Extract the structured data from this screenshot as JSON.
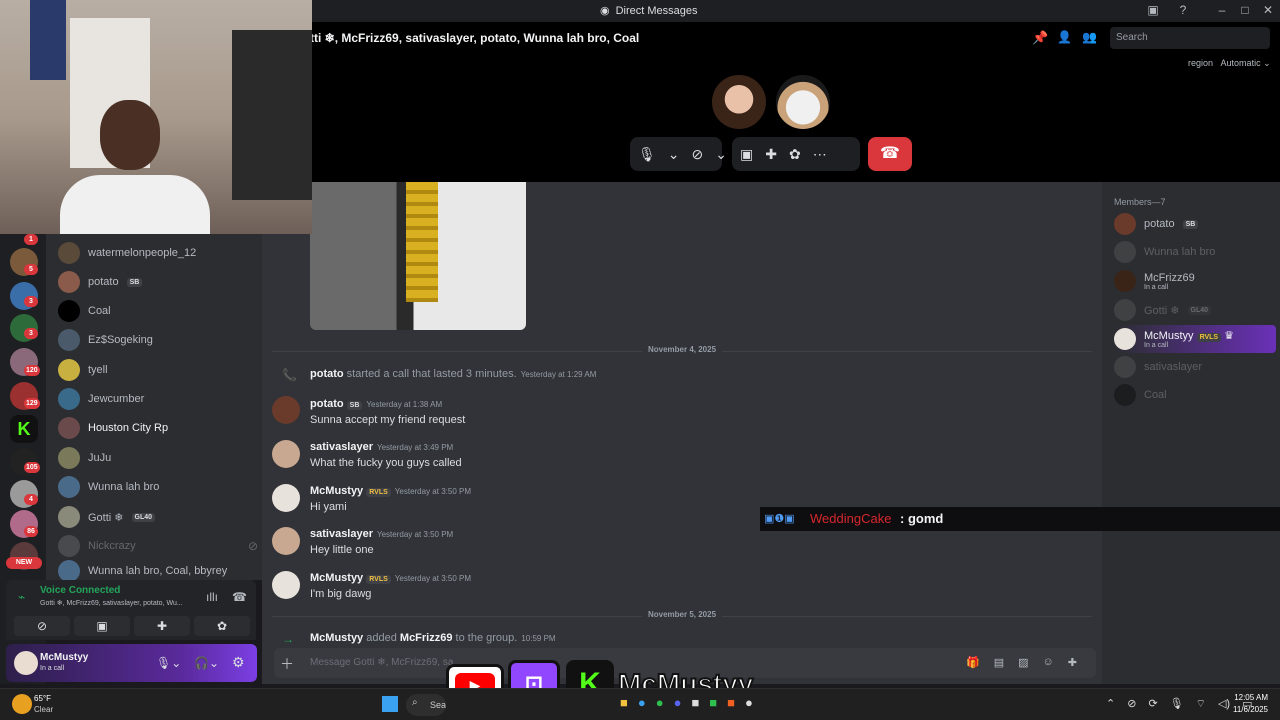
{
  "window": {
    "title": "Direct Messages"
  },
  "call": {
    "participants": "tti ❄, McFrizz69, sativaslayer, potato, Wunna lah bro, Coal",
    "search_placeholder": "Search",
    "region_label": "region",
    "region_value": "Automatic"
  },
  "servers": {
    "badges": [
      "1",
      "5",
      "3",
      "3",
      "120",
      "129",
      "105",
      "4",
      "86"
    ],
    "new_label": "NEW"
  },
  "dms": [
    {
      "name": "watermelonpeople_12",
      "tag": ""
    },
    {
      "name": "potato",
      "tag": "SB"
    },
    {
      "name": "Coal",
      "tag": ""
    },
    {
      "name": "Ez$Sogeking",
      "tag": ""
    },
    {
      "name": "tyell",
      "tag": ""
    },
    {
      "name": "Jewcumber",
      "tag": ""
    },
    {
      "name": "Houston City Rp",
      "tag": ""
    },
    {
      "name": "JuJu",
      "tag": ""
    },
    {
      "name": "Wunna lah bro",
      "tag": ""
    },
    {
      "name": "Gotti ❄",
      "tag": "GL40"
    },
    {
      "name": "Nickcrazy",
      "tag": ""
    },
    {
      "name": "Wunna lah bro, Coal, bbyrey",
      "tag": ""
    }
  ],
  "voice": {
    "status": "Voice Connected",
    "channel": "Gotti ❄, McFrizz69, sativaslayer, potato, Wu..."
  },
  "user": {
    "name": "McMustyy",
    "status": "In a call"
  },
  "messages": {
    "date1": "November 4, 2025",
    "call_user": "potato",
    "call_text": "started a call that lasted 3 minutes.",
    "call_ts": "Yesterday at 1:29 AM",
    "m1_name": "potato",
    "m1_tag": "SB",
    "m1_ts": "Yesterday at 1:38 AM",
    "m1_text": "Sunna accept my friend request",
    "m2_name": "sativaslayer",
    "m2_ts": "Yesterday at 3:49 PM",
    "m2_text": "What the fucky you guys called",
    "m3_name": "McMustyy",
    "m3_tag": "RVLS",
    "m3_ts": "Yesterday at 3:50 PM",
    "m3_text": "Hi yami",
    "m4_name": "sativaslayer",
    "m4_ts": "Yesterday at 3:50 PM",
    "m4_text": "Hey little one",
    "m5_name": "McMustyy",
    "m5_tag": "RVLS",
    "m5_ts": "Yesterday at 3:50 PM",
    "m5_text": "I'm big dawg",
    "date2": "November 5, 2025",
    "add_user": "McMustyy",
    "add_text": "added",
    "add_target": "McFrizz69",
    "add_suffix": "to the group.",
    "add_ts": "10:59 PM",
    "composer_placeholder": "Message Gotti ❄, McFrizz69, sa..."
  },
  "members": {
    "header": "Members—7",
    "list": [
      {
        "name": "potato",
        "tag": "SB",
        "sub": ""
      },
      {
        "name": "Wunna lah bro",
        "tag": "",
        "sub": ""
      },
      {
        "name": "McFrizz69",
        "tag": "",
        "sub": "In a call"
      },
      {
        "name": "Gotti ❄",
        "tag": "GL40",
        "sub": ""
      },
      {
        "name": "McMustyy",
        "tag": "RVLS",
        "sub": "In a call"
      },
      {
        "name": "sativaslayer",
        "tag": "",
        "sub": ""
      },
      {
        "name": "Coal",
        "tag": "",
        "sub": ""
      }
    ]
  },
  "stream_chat": {
    "user": "WeddingCake",
    "text": ": gomd"
  },
  "brand": {
    "name": "McMustyy"
  },
  "taskbar": {
    "temp": "65°F",
    "weather": "Clear",
    "search": "Search",
    "time": "12:05 AM",
    "date": "11/6/2025"
  },
  "colors": {
    "accent": "#5865f2",
    "danger": "#da373c",
    "online": "#23a55a",
    "brand_green": "#53fc18",
    "twitch": "#9146ff"
  }
}
